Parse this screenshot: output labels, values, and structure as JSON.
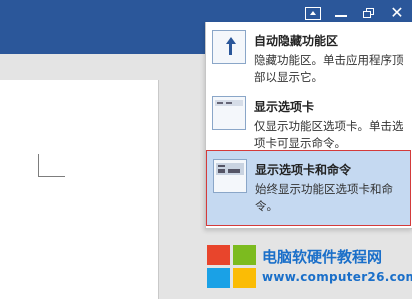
{
  "window_controls": {
    "ribbon_display_options": "ribbon-display-options-icon",
    "minimize": "minimize-icon",
    "restore": "restore-icon",
    "close_glyph": "✕"
  },
  "menu": {
    "items": [
      {
        "title": "自动隐藏功能区",
        "desc": "隐藏功能区。单击应用程序顶部以显示它。",
        "icon": "auto-hide-ribbon-icon"
      },
      {
        "title": "显示选项卡",
        "desc": "仅显示功能区选项卡。单击选项卡可显示命令。",
        "icon": "show-tabs-icon"
      },
      {
        "title": "显示选项卡和命令",
        "desc": "始终显示功能区选项卡和命令。",
        "icon": "show-tabs-and-commands-icon",
        "selected": true
      }
    ]
  },
  "watermark": {
    "title": "电脑软硬件教程网",
    "url": "www.computer26.com"
  },
  "colors": {
    "titlebar": "#2b579a",
    "selected_bg": "#c5d9f1",
    "highlight_border": "#d43a3a"
  }
}
